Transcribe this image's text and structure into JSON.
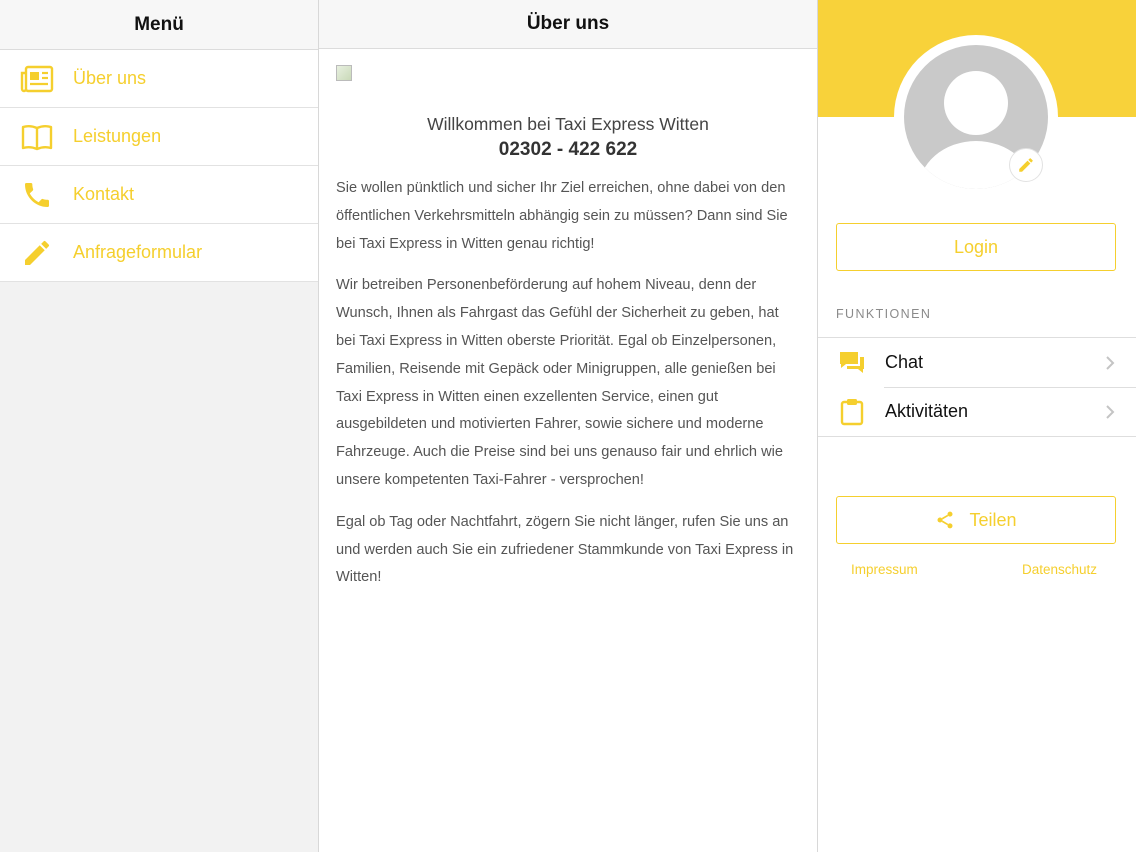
{
  "menu": {
    "title": "Menü",
    "items": [
      {
        "label": "Über uns",
        "icon": "newspaper-icon"
      },
      {
        "label": "Leistungen",
        "icon": "book-icon"
      },
      {
        "label": "Kontakt",
        "icon": "phone-icon"
      },
      {
        "label": "Anfrageformular",
        "icon": "pencil-icon"
      }
    ]
  },
  "page": {
    "title": "Über uns",
    "welcome": "Willkommen bei Taxi Express Witten",
    "phone": "02302 - 422 622",
    "paragraphs": [
      "Sie wollen pünktlich und sicher Ihr Ziel erreichen, ohne dabei von den öffentlichen Verkehrsmitteln abhängig sein zu müssen? Dann sind Sie bei Taxi Express in Witten genau richtig!",
      "Wir betreiben Personenbeförderung auf hohem Niveau, denn der Wunsch, Ihnen als Fahrgast das Gefühl der Sicherheit zu geben, hat bei Taxi Express in Witten oberste Priorität. Egal ob Einzelpersonen, Familien, Reisende mit Gepäck oder Minigruppen, alle genießen bei Taxi Express in Witten einen exzellenten Service, einen gut ausgebildeten und motivierten Fahrer, sowie sichere und moderne Fahrzeuge. Auch die Preise sind bei uns genauso fair und ehrlich wie unsere kompetenten Taxi-Fahrer - versprochen!",
      "Egal ob Tag oder Nachtfahrt, zögern Sie nicht länger, rufen Sie uns an und werden auch Sie ein zufriedener Stammkunde von Taxi Express in Witten!"
    ]
  },
  "profile": {
    "login_label": "Login",
    "section_label": "FUNKTIONEN",
    "functions": [
      {
        "label": "Chat",
        "icon": "chat-icon"
      },
      {
        "label": "Aktivitäten",
        "icon": "clipboard-icon"
      }
    ],
    "share_label": "Teilen",
    "impressum": "Impressum",
    "datenschutz": "Datenschutz"
  },
  "colors": {
    "accent": "#f5cf2e",
    "band": "#f8d23a",
    "avatar": "#c9c9c9"
  }
}
